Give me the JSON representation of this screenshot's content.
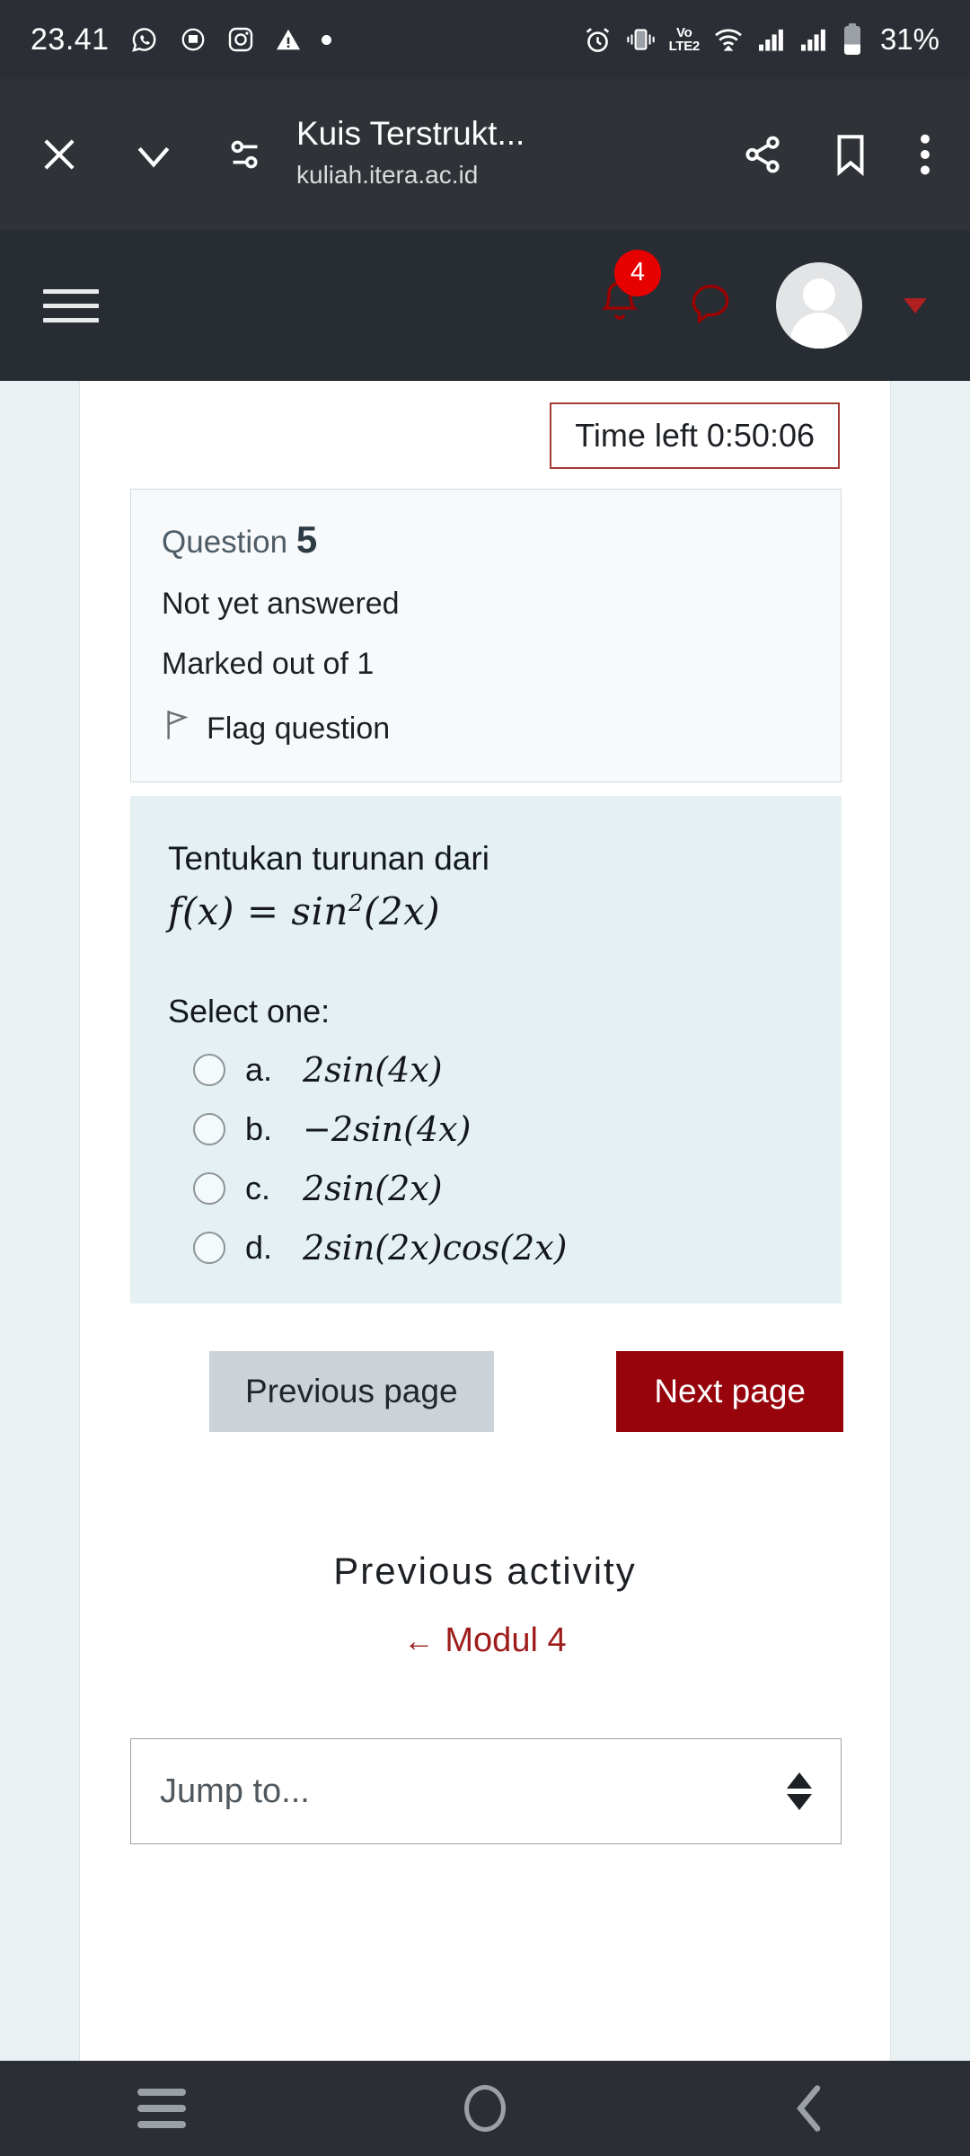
{
  "status_bar": {
    "time": "23.41",
    "battery_percent": "31%",
    "left_icons": [
      "whatsapp-icon",
      "download-icon",
      "instagram-icon",
      "warning-icon",
      "dot-icon"
    ],
    "right_icons": [
      "alarm-icon",
      "vibrate-icon",
      "volte-icon",
      "wifi-icon",
      "signal-icon-1",
      "signal-icon-2",
      "battery-icon"
    ],
    "volte_top": "Vo",
    "volte_bottom": "LTE2"
  },
  "browser_bar": {
    "close_icon": "close-icon",
    "chevron_icon": "chevron-down-icon",
    "settings_icon": "page-settings-icon",
    "title": "Kuis Terstrukt...",
    "url": "kuliah.itera.ac.id",
    "share_icon": "share-icon",
    "bookmark_icon": "bookmark-icon",
    "overflow_icon": "more-vertical-icon"
  },
  "moodle_nav": {
    "menu_icon": "hamburger-menu-icon",
    "notification_icon": "bell-icon",
    "notification_count": "4",
    "message_icon": "message-bubble-icon",
    "avatar": "user-avatar",
    "caret": "caret-down-icon"
  },
  "quiz": {
    "timer_label": "Time left 0:50:06",
    "question_label": "Question",
    "question_number": "5",
    "answer_state": "Not yet answered",
    "marked_out_of": "Marked out of 1",
    "flag_label": "Flag question",
    "question_text": "Tentukan turunan dari",
    "formula_prefix": "f(x) = sin",
    "formula_exponent": "2",
    "formula_suffix": "(2x)",
    "select_one": "Select one:",
    "options": [
      {
        "letter": "a.",
        "text": "2sin(4x)"
      },
      {
        "letter": "b.",
        "text": "−2sin(4x)"
      },
      {
        "letter": "c.",
        "text": "2sin(2x)"
      },
      {
        "letter": "d.",
        "text": "2sin(2x)cos(2x)"
      }
    ],
    "previous_page_label": "Previous page",
    "next_page_label": "Next page"
  },
  "footer": {
    "previous_activity_heading": "Previous activity",
    "previous_activity_arrow": "←",
    "previous_activity_link": "Modul 4",
    "jump_to_placeholder": "Jump to..."
  },
  "android_nav": {
    "recents_icon": "recents-icon",
    "home_icon": "home-circle-icon",
    "back_icon": "back-chevron-icon"
  },
  "colors": {
    "status_bar_bg": "#2b2f35",
    "browser_bar_bg": "#2f3337",
    "moodle_nav_bg": "#282c33",
    "page_bg": "#eaf1f3",
    "card_bg": "#ffffff",
    "question_body_bg": "#e4f0f2",
    "primary_red": "#97040c",
    "link_red": "#9e1b1b",
    "badge_red": "#e60000",
    "timer_border": "#a33b35"
  }
}
